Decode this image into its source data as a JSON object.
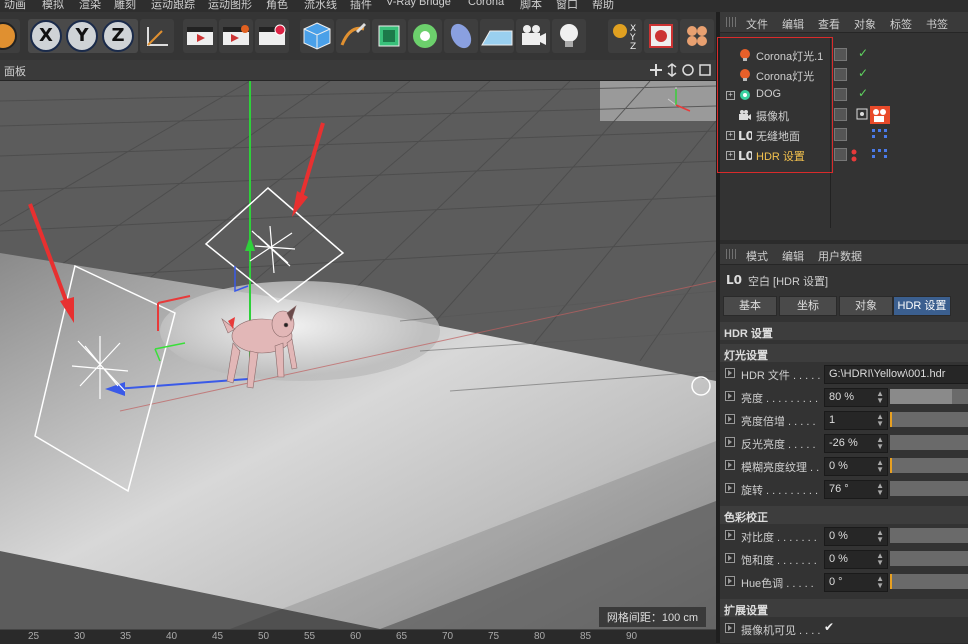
{
  "menu": [
    "动画",
    "模拟",
    "渲染",
    "雕刻",
    "运动跟踪",
    "运动图形",
    "角色",
    "流水线",
    "插件",
    "V-Ray Bridge",
    "Corona",
    "脚本",
    "窗口",
    "帮助"
  ],
  "toolbar": {
    "axes": [
      "X",
      "Y",
      "Z"
    ]
  },
  "viewport": {
    "panel_label": "面板",
    "grid_spacing": "网格间距：100 cm",
    "ruler_ticks": [
      "25",
      "30",
      "35",
      "40",
      "45",
      "50",
      "55",
      "60",
      "65",
      "70",
      "75",
      "80",
      "85",
      "90"
    ]
  },
  "object_manager": {
    "menu": [
      "文件",
      "编辑",
      "查看",
      "对象",
      "标签",
      "书签"
    ],
    "objects": [
      {
        "name": "Corona灯光.1",
        "icon": "light-bulb-icon",
        "selected": false
      },
      {
        "name": "Corona灯光",
        "icon": "light-bulb-icon",
        "selected": false
      },
      {
        "name": "DOG",
        "icon": "object-icon",
        "selected": false
      },
      {
        "name": "摄像机",
        "icon": "camera-icon",
        "selected": false
      },
      {
        "name": "无缝地面",
        "icon": "null-object-icon",
        "selected": false
      },
      {
        "name": "HDR 设置",
        "icon": "null-object-icon",
        "selected": true
      }
    ]
  },
  "attribute_manager": {
    "menu": [
      "模式",
      "编辑",
      "用户数据"
    ],
    "title": "空白 [HDR 设置]",
    "tabs": [
      "基本",
      "坐标",
      "对象",
      "HDR 设置"
    ],
    "active_tab": "HDR 设置",
    "section_main": "HDR 设置",
    "section_light": "灯光设置",
    "section_color": "色彩校正",
    "section_ext": "扩展设置",
    "light_props": [
      {
        "label": "HDR 文件 . . . . .",
        "value": "G:\\HDRI\\Yellow\\001.hdr"
      },
      {
        "label": "亮度 . . . . . . . . .",
        "value": "80 %",
        "slider": 0.8,
        "mark": null
      },
      {
        "label": "亮度倍增 . . . . .",
        "value": "1",
        "slider": 0.0,
        "mark": 0.0
      },
      {
        "label": "反光亮度 . . . . .",
        "value": "-26 %",
        "slider": 0.0,
        "mark": null
      },
      {
        "label": "模糊亮度纹理 . .",
        "value": "0 %",
        "slider": 0.0,
        "mark": 0.0
      },
      {
        "label": "旋转 . . . . . . . . .",
        "value": "76 °",
        "slider": 0.0,
        "mark": null
      }
    ],
    "color_props": [
      {
        "label": "对比度 . . . . . . .",
        "value": "0 %"
      },
      {
        "label": "饱和度 . . . . . . .",
        "value": "0 %"
      },
      {
        "label": "Hue色调 . . . . .",
        "value": "0 °"
      }
    ],
    "ext_props": [
      {
        "label": "摄像机可见 . . . .",
        "value": "✔"
      }
    ]
  },
  "colors": {
    "accent_blue": "#3b5f8f",
    "selected_text": "#f2c14e",
    "annotation_red": "#d92b2b"
  }
}
